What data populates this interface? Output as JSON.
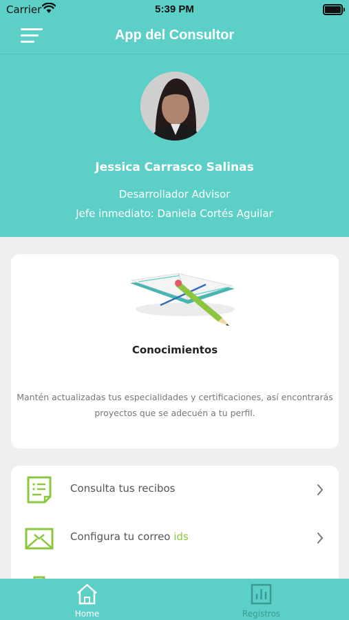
{
  "status_bar": {
    "carrier": "Carrier",
    "time": "5:39 PM"
  },
  "header": {
    "title": "App del Consultor"
  },
  "profile": {
    "name": "Jessica Carrasco Salinas",
    "role": "Desarrollador Advisor",
    "manager": "Jefe inmediato: Daniela Cortés Aguilar"
  },
  "knowledge_card": {
    "title": "Conocimientos",
    "description": "Mantén actualizadas tus especialidades y certificaciones, así encontrarás proyectos que se adecuén a tu perfil."
  },
  "menu": {
    "items": [
      {
        "label": "Consulta tus recibos",
        "icon": "receipt-icon"
      },
      {
        "label": "Configura tu correo ",
        "accent": "ids",
        "icon": "mail-icon"
      }
    ]
  },
  "tabs": [
    {
      "label": "Home",
      "icon": "home-icon",
      "active": true
    },
    {
      "label": "Registros",
      "icon": "chart-icon",
      "active": false
    }
  ],
  "colors": {
    "primary": "#5ccfc7",
    "accent": "#8cc63f",
    "background": "#efefef"
  }
}
